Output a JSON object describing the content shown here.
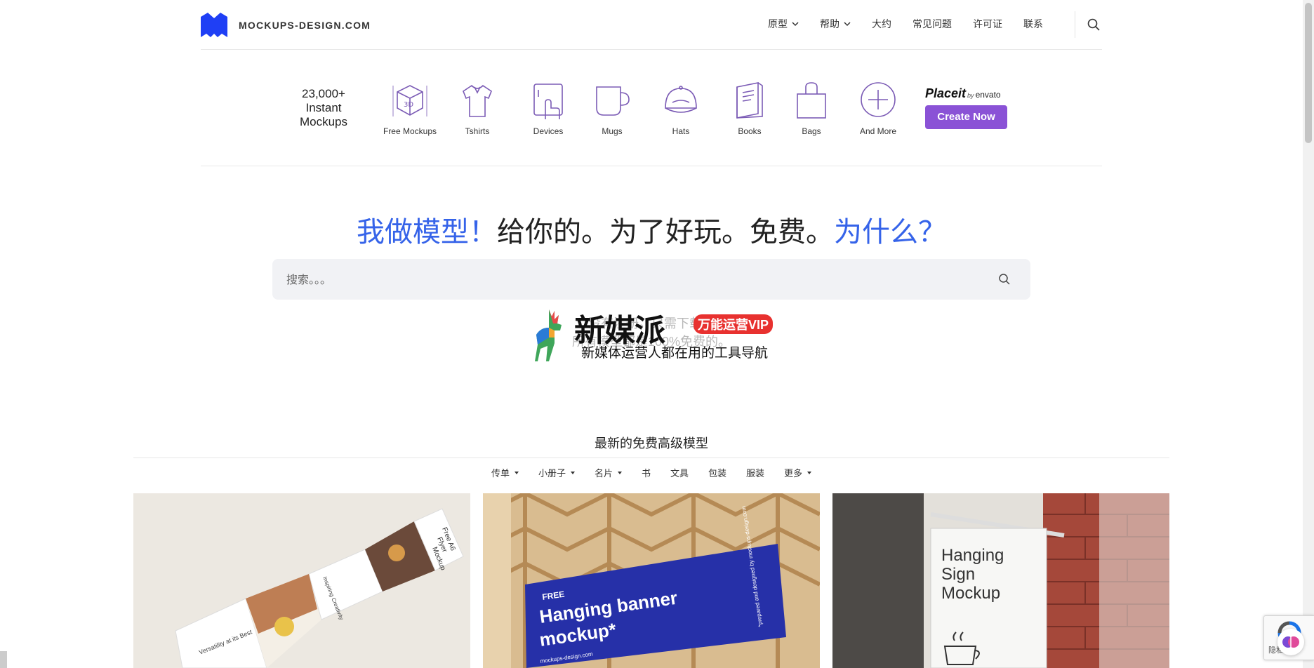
{
  "header": {
    "logo_text": "MOCKUPS-DESIGN.COM",
    "nav": [
      {
        "label": "原型",
        "dropdown": true
      },
      {
        "label": "帮助",
        "dropdown": true
      },
      {
        "label": "大约",
        "dropdown": false
      },
      {
        "label": "常见问题",
        "dropdown": false
      },
      {
        "label": "许可证",
        "dropdown": false
      },
      {
        "label": "联系",
        "dropdown": false
      }
    ]
  },
  "strip": {
    "title_line1": "23,000+",
    "title_line2": "Instant",
    "title_line3": "Mockups",
    "categories": [
      {
        "label": "Free Mockups",
        "icon": "3d-box-icon"
      },
      {
        "label": "Tshirts",
        "icon": "tshirt-icon"
      },
      {
        "label": "Devices",
        "icon": "tablet-hand-icon"
      },
      {
        "label": "Mugs",
        "icon": "mug-icon"
      },
      {
        "label": "Hats",
        "icon": "cap-icon"
      },
      {
        "label": "Books",
        "icon": "book-icon"
      },
      {
        "label": "Bags",
        "icon": "bag-icon"
      },
      {
        "label": "And More",
        "icon": "plus-circle-icon"
      }
    ],
    "placeit_name": "Placeit",
    "placeit_by": "by",
    "placeit_envato": "envato",
    "create_button": "Create Now"
  },
  "hero": {
    "title_part1": "我做模型！",
    "title_part2": "给你的。为了好玩。免费。",
    "title_part3": "为什么？",
    "search_placeholder": "搜索。。。",
    "sub_line1": "没有注册。只需下载。",
    "sub_line2": "所有模型都是100%免费的。"
  },
  "watermark": {
    "big_text": "新媒派",
    "badge": "万能运营VIP",
    "small_text": "新媒体运营人都在用的工具导航"
  },
  "latest": {
    "title": "最新的免费高级模型",
    "filters": [
      {
        "label": "传单",
        "dropdown": true
      },
      {
        "label": "小册子",
        "dropdown": true
      },
      {
        "label": "名片",
        "dropdown": true
      },
      {
        "label": "书",
        "dropdown": false
      },
      {
        "label": "文具",
        "dropdown": false
      },
      {
        "label": "包装",
        "dropdown": false
      },
      {
        "label": "服装",
        "dropdown": false
      },
      {
        "label": "更多",
        "dropdown": true
      }
    ],
    "cards": [
      {
        "text1": "Free A6",
        "text2": "Flyer",
        "text3": "Mockup",
        "text4": "Versatility at its Best",
        "text5": "Inspiring Creativity"
      },
      {
        "free": "FREE",
        "title1": "Hanging banner",
        "title2": "mockup*",
        "footer": "mockups-design.com",
        "side": "*prepared and designed by mockups-design.com"
      },
      {
        "line1": "Hanging",
        "line2": "Sign",
        "line3": "Mockup"
      }
    ]
  },
  "recaptcha_label": "隐私",
  "colors": {
    "brand_blue": "#1f3ff5",
    "accent_blue": "#3563e9",
    "placeit_purple": "#8a52d6",
    "icon_purple": "#7b5bb5"
  }
}
